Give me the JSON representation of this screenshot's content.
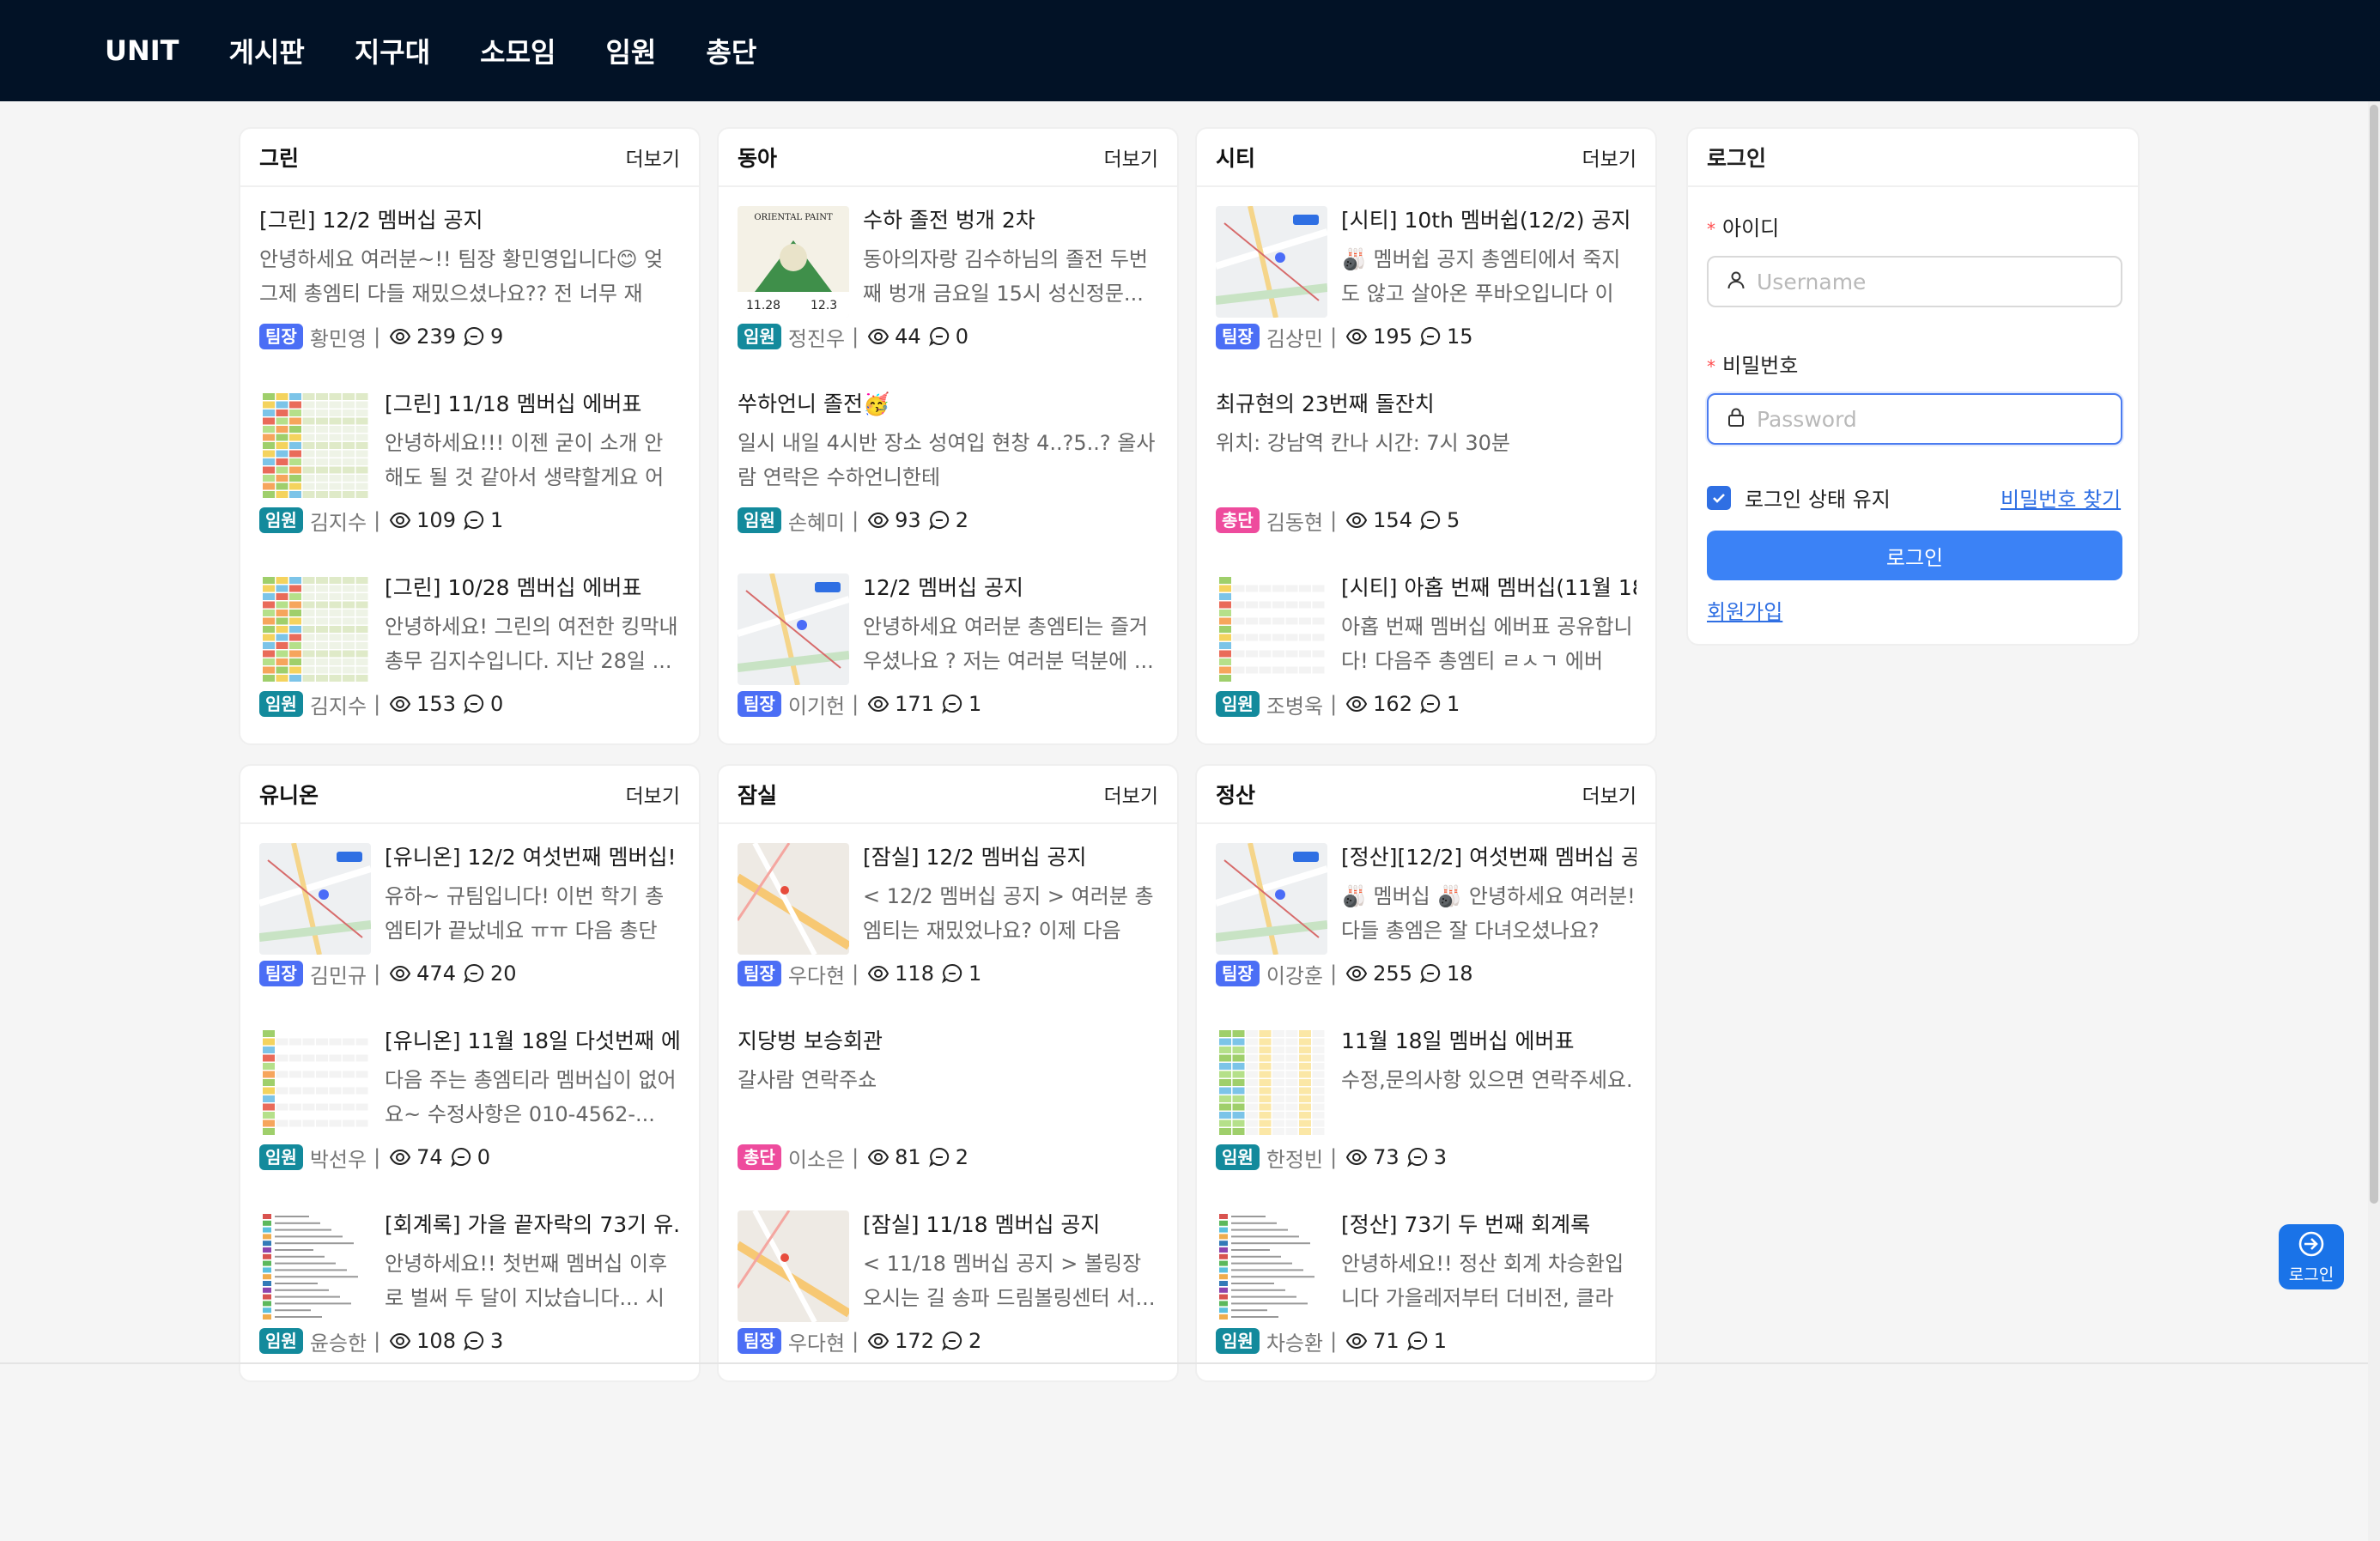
{
  "nav": {
    "brand": "UNIT",
    "items": [
      "게시판",
      "지구대",
      "소모임",
      "임원",
      "총단"
    ]
  },
  "more_label": "더보기",
  "boards": [
    {
      "title": "그린",
      "posts": [
        {
          "title": "[그린] 12/2 멤버십 공지",
          "body": "안녕하세요 여러분~!! 팀장 황민영입니다😊   엊그제 총엠티 다들 재밌으셨나요?? 전 너무 재밌...",
          "badge": "팀장",
          "badge_type": "leader",
          "author": "황민영",
          "views": "239",
          "comments": "9",
          "thumb": null
        },
        {
          "title": "[그린] 11/18 멤버십 에버표",
          "body": "안녕하세요!!! 이젠 굳이 소개 안해도 될 것 같아서 생략할게요 어떻...",
          "badge": "임원",
          "badge_type": "exec",
          "author": "김지수",
          "views": "109",
          "comments": "1",
          "thumb": "sheet"
        },
        {
          "title": "[그린] 10/28 멤버십 에버표",
          "body": "안녕하세요! 그린의 여전한 킹막내 총무 김지수입니다. 지난 28일 ...",
          "badge": "임원",
          "badge_type": "exec",
          "author": "김지수",
          "views": "153",
          "comments": "0",
          "thumb": "sheet"
        }
      ]
    },
    {
      "title": "동아",
      "posts": [
        {
          "title": "수하 졸전 벙개 2차",
          "body": "동아의자랑 김수하님의 졸전 두번째 벙개   금요일 15시  성신정문...",
          "badge": "임원",
          "badge_type": "exec",
          "author": "정진우",
          "views": "44",
          "comments": "0",
          "thumb": "poster"
        },
        {
          "title": "쑤하언니 졸전🥳",
          "body": "일시 내일 4시반 장소 성여입 현창 4..?5..? 올사람 연락은 수하언니한테",
          "badge": "임원",
          "badge_type": "exec",
          "author": "손혜미",
          "views": "93",
          "comments": "2",
          "thumb": null
        },
        {
          "title": "12/2 멤버십 공지",
          "body": "안녕하세요 여러분 총엠티는 즐거우셨나요 ? 저는 여러분 덕분에 ...",
          "badge": "팀장",
          "badge_type": "leader",
          "author": "이기헌",
          "views": "171",
          "comments": "1",
          "thumb": "map"
        }
      ]
    },
    {
      "title": "시티",
      "posts": [
        {
          "title": "[시티] 10th 멤버쉽(12/2) 공지",
          "body": "🎳 멤버쉽 공지 총엠티에서 죽지도 않고 살아온 푸바오입니다  이번...",
          "badge": "팀장",
          "badge_type": "leader",
          "author": "김상민",
          "views": "195",
          "comments": "15",
          "thumb": "map"
        },
        {
          "title": "최규현의 23번째 돌잔치",
          "body": "위치: 강남역 칸나 시간: 7시 30분",
          "badge": "총단",
          "badge_type": "chief",
          "author": "김동현",
          "views": "154",
          "comments": "5",
          "thumb": null
        },
        {
          "title": "[시티] 아홉 번째 멤버십(11월 18...",
          "body": "아홉 번째 멤버십 에버표 공유합니다! 다음주 총엠티 ㄹㅅㄱ 에버표...",
          "badge": "임원",
          "badge_type": "exec",
          "author": "조병욱",
          "views": "162",
          "comments": "1",
          "thumb": "sheet2"
        }
      ]
    },
    {
      "title": "유니온",
      "posts": [
        {
          "title": "[유니온] 12/2 여섯번째 멤버십!",
          "body": "유하~ 규팀입니다! 이번 학기 총엠티가 끝났네요 ㅠㅠ 다음 총단행...",
          "badge": "팀장",
          "badge_type": "leader",
          "author": "김민규",
          "views": "474",
          "comments": "20",
          "thumb": "map"
        },
        {
          "title": "[유니온] 11월 18일 다섯번째 에...",
          "body": "다음 주는 총엠티라 멤버십이 없어요~ 수정사항은 010-4562-...",
          "badge": "임원",
          "badge_type": "exec",
          "author": "박선우",
          "views": "74",
          "comments": "0",
          "thumb": "sheet2"
        },
        {
          "title": "[회계록] 가을 끝자락의 73기 유...",
          "body": "안녕하세요!! 첫번째 멤버십 이후로 벌써 두 달이 지났습니다... 시간 ...",
          "badge": "임원",
          "badge_type": "exec",
          "author": "윤승한",
          "views": "108",
          "comments": "3",
          "thumb": "ledger"
        }
      ]
    },
    {
      "title": "잠실",
      "posts": [
        {
          "title": "[잠실] 12/2 멤버십 공지",
          "body": "< 12/2 멤버십 공지 >    여러분 총엠티는 재밌었나요? 이제 다음 총...",
          "badge": "팀장",
          "badge_type": "leader",
          "author": "우다현",
          "views": "118",
          "comments": "1",
          "thumb": "map2"
        },
        {
          "title": "지당벙 보승회관",
          "body": "갈사람 연락주쇼",
          "badge": "총단",
          "badge_type": "chief",
          "author": "이소은",
          "views": "81",
          "comments": "2",
          "thumb": null
        },
        {
          "title": "[잠실] 11/18 멤버십 공지",
          "body": "< 11/18 멤버십 공지 >     볼링장 오시는 길 송파 드림볼링센터 서...",
          "badge": "팀장",
          "badge_type": "leader",
          "author": "우다현",
          "views": "172",
          "comments": "2",
          "thumb": "map2"
        }
      ]
    },
    {
      "title": "정산",
      "posts": [
        {
          "title": "[정산][12/2] 여섯번째 멤버십 공...",
          "body": "🎳 멤버십 🎳 안녕하세요 여러분! 다들 총엠은 잘 다녀오셨나요? 저...",
          "badge": "팀장",
          "badge_type": "leader",
          "author": "이강훈",
          "views": "255",
          "comments": "18",
          "thumb": "map"
        },
        {
          "title": "11월 18일 멤버십 에버표",
          "body": "수정,문의사항 있으면 연락주세요.",
          "badge": "임원",
          "badge_type": "exec",
          "author": "한정빈",
          "views": "73",
          "comments": "3",
          "thumb": "sheet3"
        },
        {
          "title": "[정산] 73기 두 번째 회계록",
          "body": "안녕하세요!! 정산 회계 차승환입니다 가을레저부터 더비전, 클라이...",
          "badge": "임원",
          "badge_type": "exec",
          "author": "차승환",
          "views": "71",
          "comments": "1",
          "thumb": "ledger2"
        }
      ]
    }
  ],
  "login": {
    "title": "로그인",
    "id_label": "아이디",
    "id_placeholder": "Username",
    "pw_label": "비밀번호",
    "pw_placeholder": "Password",
    "remember_label": "로그인 상태 유지",
    "find_pw": "비밀번호 찾기",
    "submit": "로그인",
    "signup": "회원가입"
  },
  "float_login": "로그인",
  "colors": {
    "nav_bg": "#021226",
    "leader": "#4b6ef5",
    "exec": "#138a9c",
    "chief": "#ee4b9d",
    "primary": "#3b82f6"
  }
}
